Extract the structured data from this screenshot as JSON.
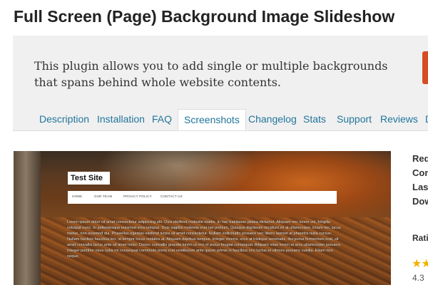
{
  "plugin": {
    "title": "Full Screen (Page) Background Image Slideshow",
    "description": "This plugin allows you to add single or multiple backgrounds that spans behind whole website contents."
  },
  "tabs": [
    "Description",
    "Installation",
    "FAQ",
    "Screenshots",
    "Changelog",
    "Stats",
    "Support",
    "Reviews",
    "D"
  ],
  "active_tab": "Screenshots",
  "screenshot": {
    "site_title": "Test Site",
    "nav": [
      "HOME",
      "OUR TEAM",
      "PRIVACY POLICY",
      "CONTACT US"
    ],
    "body_text": "Lorem ipsum dolor sit amet consectetur adipiscing elit. Duis eleifend molestie mattis. In hac habitasse platea dictumst. Aliquam nec lorem vel, fringilla volutpat nunc. In pellentesque euismod eros tempus. Duis sagittis molestie erat net pretium. Quisque dignissim tincidunt mi at ullamcorper. Etiam nec lacus metus, non euismod dui. Phasellus egestas eleifend turpis sit amet consectetur. Nullam sollicitudin posuere nec libero laoreet at pharetra nulla cursus. Nullam facilisis faucibus leo, id tempor locus sodales at. Aliquam dapibus tempus. Integer viverra, eros at tristique venenatis, dui purus fermentum erat, sit amet convallis lacus ante sit amet tortor. Donec convallis gravida lorem ut orci et purus feugiat consequat. Aliquam vitae lorem at arcu ullamcorper posuere. Integer porttitor risus nulla mi consequat commodo porta erat vestibulum ante ipsum primis in faucibus orci luctus et ultrices posuere cubilia. Etiam non neque."
  },
  "sidebar": {
    "meta": [
      "Req",
      "Com",
      "Las",
      "Dow"
    ],
    "ratings_label": "Rati",
    "stars": "★★",
    "rating_value": "4.3"
  },
  "colors": {
    "link": "#21759b",
    "download": "#d54e21",
    "banner_bg": "#f0f0f0"
  }
}
